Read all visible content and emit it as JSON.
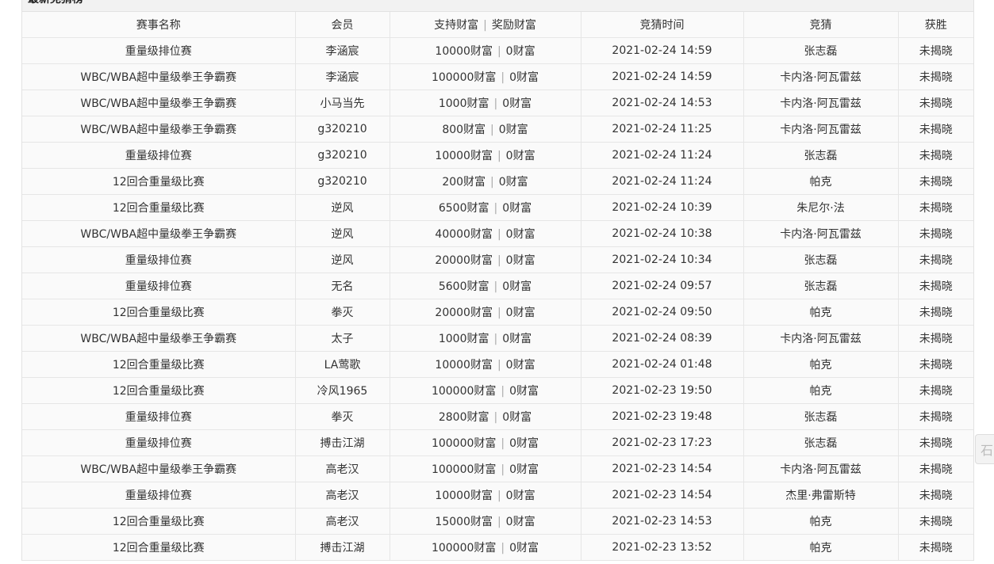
{
  "panel": {
    "title": "最新竞猜榜"
  },
  "table": {
    "headers": {
      "event": "赛事名称",
      "member": "会员",
      "support": "支持财富",
      "separator": "|",
      "reward": "奖励财富",
      "time": "竞猜时间",
      "guess": "竞猜",
      "winner": "获胜"
    },
    "rows": [
      {
        "event": "重量级排位赛",
        "member": "李涵宸",
        "support": "10000财富",
        "reward": "0财富",
        "time": "2021-02-24 14:59",
        "guess": "张志磊",
        "winner": "未揭晓"
      },
      {
        "event": "WBC/WBA超中量级拳王争霸赛",
        "member": "李涵宸",
        "support": "100000财富",
        "reward": "0财富",
        "time": "2021-02-24 14:59",
        "guess": "卡内洛·阿瓦雷兹",
        "winner": "未揭晓"
      },
      {
        "event": "WBC/WBA超中量级拳王争霸赛",
        "member": "小马当先",
        "support": "1000财富",
        "reward": "0财富",
        "time": "2021-02-24 14:53",
        "guess": "卡内洛·阿瓦雷兹",
        "winner": "未揭晓"
      },
      {
        "event": "WBC/WBA超中量级拳王争霸赛",
        "member": "g320210",
        "support": "800财富",
        "reward": "0财富",
        "time": "2021-02-24 11:25",
        "guess": "卡内洛·阿瓦雷兹",
        "winner": "未揭晓"
      },
      {
        "event": "重量级排位赛",
        "member": "g320210",
        "support": "10000财富",
        "reward": "0财富",
        "time": "2021-02-24 11:24",
        "guess": "张志磊",
        "winner": "未揭晓"
      },
      {
        "event": "12回合重量级比赛",
        "member": "g320210",
        "support": "200财富",
        "reward": "0财富",
        "time": "2021-02-24 11:24",
        "guess": "帕克",
        "winner": "未揭晓"
      },
      {
        "event": "12回合重量级比赛",
        "member": "逆风",
        "support": "6500财富",
        "reward": "0财富",
        "time": "2021-02-24 10:39",
        "guess": "朱尼尔·法",
        "winner": "未揭晓"
      },
      {
        "event": "WBC/WBA超中量级拳王争霸赛",
        "member": "逆风",
        "support": "40000财富",
        "reward": "0财富",
        "time": "2021-02-24 10:38",
        "guess": "卡内洛·阿瓦雷兹",
        "winner": "未揭晓"
      },
      {
        "event": "重量级排位赛",
        "member": "逆风",
        "support": "20000财富",
        "reward": "0财富",
        "time": "2021-02-24 10:34",
        "guess": "张志磊",
        "winner": "未揭晓"
      },
      {
        "event": "重量级排位赛",
        "member": "无名",
        "support": "5600财富",
        "reward": "0财富",
        "time": "2021-02-24 09:57",
        "guess": "张志磊",
        "winner": "未揭晓"
      },
      {
        "event": "12回合重量级比赛",
        "member": "拳灭",
        "support": "20000财富",
        "reward": "0财富",
        "time": "2021-02-24 09:50",
        "guess": "帕克",
        "winner": "未揭晓"
      },
      {
        "event": "WBC/WBA超中量级拳王争霸赛",
        "member": "太子",
        "support": "1000财富",
        "reward": "0财富",
        "time": "2021-02-24 08:39",
        "guess": "卡内洛·阿瓦雷兹",
        "winner": "未揭晓"
      },
      {
        "event": "12回合重量级比赛",
        "member": "LA莺歌",
        "support": "10000财富",
        "reward": "0财富",
        "time": "2021-02-24 01:48",
        "guess": "帕克",
        "winner": "未揭晓"
      },
      {
        "event": "12回合重量级比赛",
        "member": "冷风1965",
        "support": "100000财富",
        "reward": "0财富",
        "time": "2021-02-23 19:50",
        "guess": "帕克",
        "winner": "未揭晓"
      },
      {
        "event": "重量级排位赛",
        "member": "拳灭",
        "support": "2800财富",
        "reward": "0财富",
        "time": "2021-02-23 19:48",
        "guess": "张志磊",
        "winner": "未揭晓"
      },
      {
        "event": "重量级排位赛",
        "member": "搏击江湖",
        "support": "100000财富",
        "reward": "0财富",
        "time": "2021-02-23 17:23",
        "guess": "张志磊",
        "winner": "未揭晓"
      },
      {
        "event": "WBC/WBA超中量级拳王争霸赛",
        "member": "高老汉",
        "support": "100000财富",
        "reward": "0财富",
        "time": "2021-02-23 14:54",
        "guess": "卡内洛·阿瓦雷兹",
        "winner": "未揭晓"
      },
      {
        "event": "重量级排位赛",
        "member": "高老汉",
        "support": "10000财富",
        "reward": "0财富",
        "time": "2021-02-23 14:54",
        "guess": "杰里·弗雷斯特",
        "winner": "未揭晓"
      },
      {
        "event": "12回合重量级比赛",
        "member": "高老汉",
        "support": "15000财富",
        "reward": "0财富",
        "time": "2021-02-23 14:53",
        "guess": "帕克",
        "winner": "未揭晓"
      },
      {
        "event": "12回合重量级比赛",
        "member": "搏击江湖",
        "support": "100000财富",
        "reward": "0财富",
        "time": "2021-02-23 13:52",
        "guess": "帕克",
        "winner": "未揭晓"
      }
    ]
  },
  "side_tab": {
    "icon": "scroll-tab-icon",
    "glyph": "石"
  }
}
